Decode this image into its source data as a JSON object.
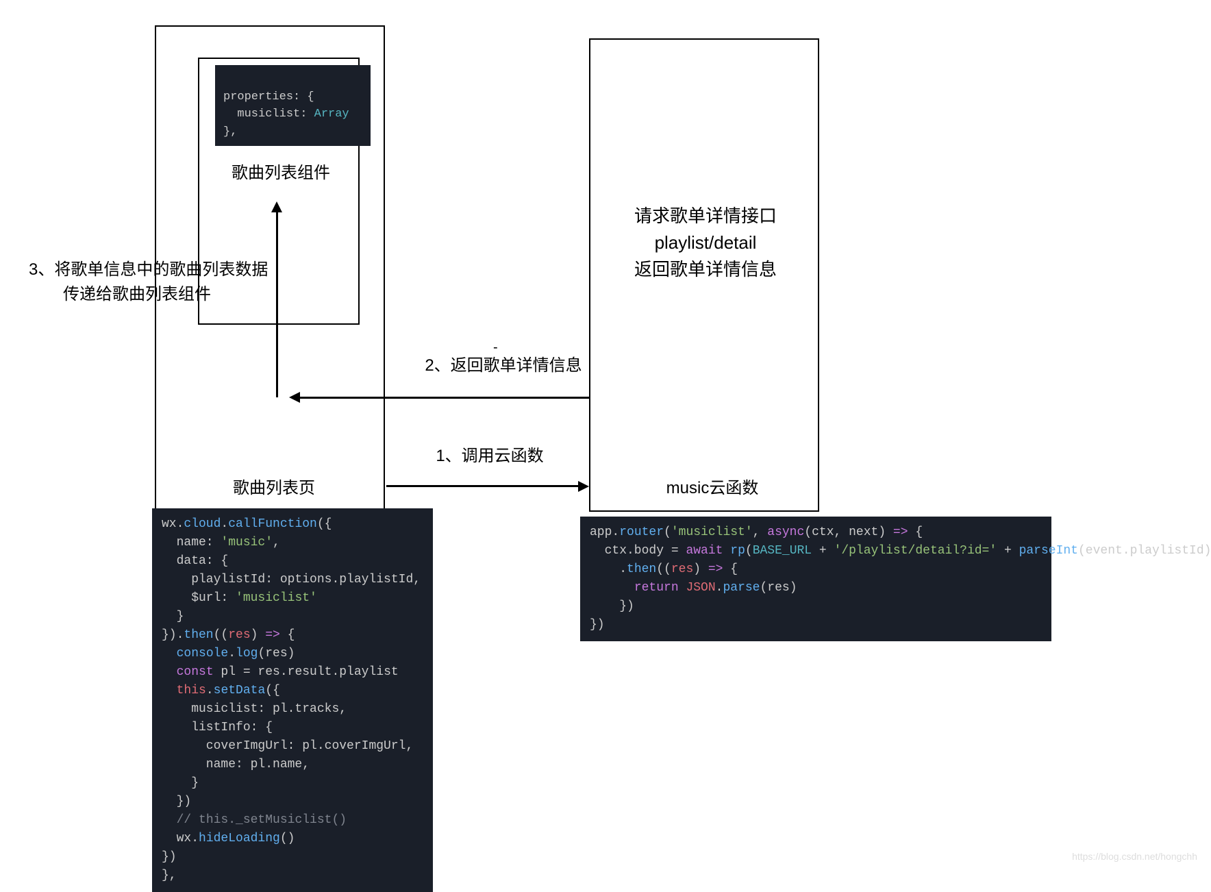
{
  "leftBox": {
    "componentLabel": "歌曲列表组件",
    "pageLabel": "歌曲列表页",
    "propertiesCode": {
      "line1": "properties: {",
      "line2_prefix": "  musiclist: ",
      "line2_type": "Array",
      "line3": "},"
    }
  },
  "rightBox": {
    "apiLabel_line1": "请求歌单详情接口playlist/detail",
    "apiLabel_line2": "返回歌单详情信息",
    "cloudLabel": "music云函数"
  },
  "annotations": {
    "step1": "1、调用云函数",
    "step2": "2、返回歌单详情信息",
    "step3_line1": "3、将歌单信息中的歌曲列表数据",
    "step3_line2": "传递给歌曲列表组件"
  },
  "leftCode": {
    "raw": "wx.cloud.callFunction({\n  name: 'music',\n  data: {\n    playlistId: options.playlistId,\n    $url: 'musiclist'\n  }\n}).then((res) => {\n  console.log(res)\n  const pl = res.result.playlist\n  this.setData({\n    musiclist: pl.tracks,\n    listInfo: {\n      coverImgUrl: pl.coverImgUrl,\n      name: pl.name,\n    }\n  })\n  // this._setMusiclist()\n  wx.hideLoading()\n})\n},"
  },
  "rightCode": {
    "raw": "app.router('musiclist', async(ctx, next) => {\n  ctx.body = await rp(BASE_URL + '/playlist/detail?id=' + parseInt(event.playlistId))\n    .then((res) => {\n      return JSON.parse(res)\n    })\n})"
  },
  "watermark": "https://blog.csdn.net/hongchh"
}
